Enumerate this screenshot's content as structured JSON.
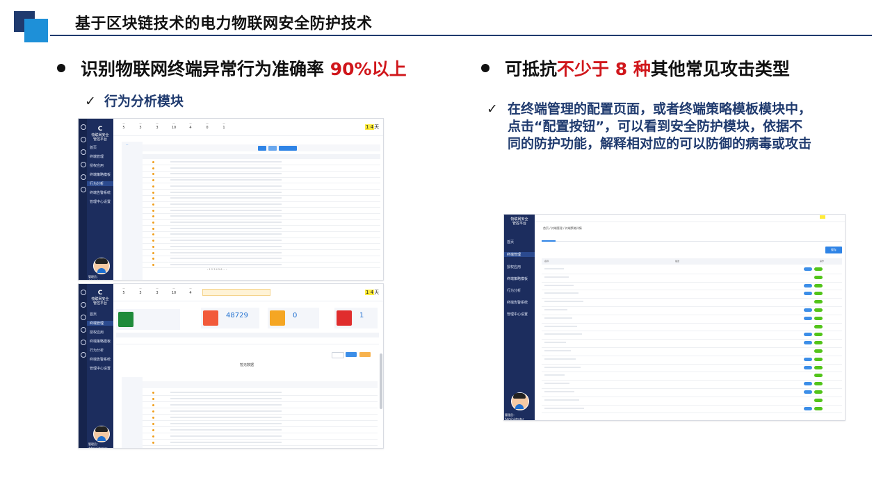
{
  "slide": {
    "title": "基于区块链技术的电力物联网安全防护技术",
    "left_bullet": {
      "text": "识别物联网终端异常行为准确率",
      "highlight": "90%以上"
    },
    "left_sub": "行为分析模块",
    "right_bullet": {
      "before": "可抵抗",
      "highlight": "不少于 8 种",
      "after": "其他常见攻击类型"
    },
    "right_desc": "在终端管理的配置页面，或者终端策略模板模块中，点击“配置按钮”，可以看到安全防护模块，依据不同的防护功能，解释相对应的可以防御的病毒或攻击",
    "check_mark": "✓",
    "colors": {
      "accent_red": "#d0161b",
      "navy": "#1f3a6e",
      "blue": "#1e90d8"
    }
  },
  "app": {
    "brand_line1": "物联网安全",
    "brand_line2": "管控平台",
    "admin": "管理员：Administrator",
    "days_digits": "1 4",
    "days_unit": "天",
    "menu": [
      "首页",
      "终端管理",
      "授权应用",
      "终端策略模板",
      "行为分析",
      "终端告警系统",
      "管理中心设置"
    ],
    "dashboard": {
      "card1_value": "48729",
      "card2_value": "0",
      "card3_value": "1",
      "no_data": "暂无数据"
    },
    "panel3_crumb": "首页 / 终端管理 / 终端策略详情",
    "panel3_button": "保存",
    "panel3_col1": "名称",
    "panel3_col2": "描述",
    "panel3_col3": "操作"
  },
  "icons": [
    "check-icon",
    "bullet-dot-icon",
    "avatar-icon"
  ]
}
